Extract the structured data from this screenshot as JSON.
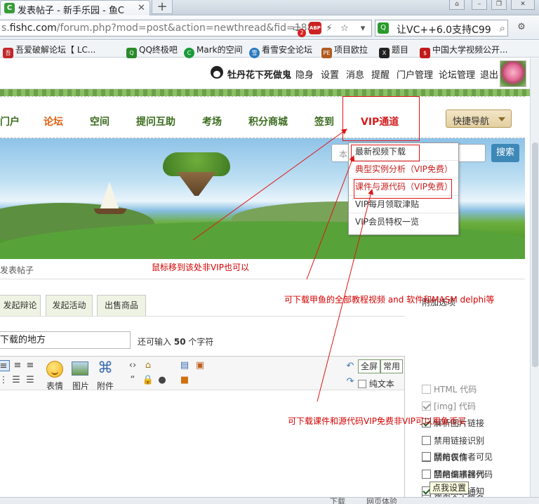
{
  "browser": {
    "tab_title": "发表帖子 - 新手乐园 - 鱼C",
    "tab_favicon": "C",
    "url_prefix": "s.",
    "url_domain": "fishc.com",
    "url_path": "/forum.php?mod=post&action=newthread&fid=188",
    "notification_count": "2",
    "adblock_label": "ABP",
    "search_query": "让VC++6.0支持C99",
    "bookmarks": [
      {
        "label": "吾爱破解论坛【 LC...",
        "icon_text": "吾"
      },
      {
        "label": "QQ终极吧",
        "icon_text": "Q"
      },
      {
        "label": "Mark的空间",
        "icon_text": "C"
      },
      {
        "label": "看雪安全论坛",
        "icon_text": "雪"
      },
      {
        "label": "项目欧拉",
        "icon_text": "PE"
      },
      {
        "label": "题目",
        "icon_text": "X"
      },
      {
        "label": "中国大学视频公开...",
        "icon_text": "$"
      }
    ]
  },
  "topbar": {
    "username": "牡丹花下死做鬼",
    "links": [
      "隐身",
      "设置",
      "消息",
      "提醒",
      "门户管理",
      "论坛管理",
      "退出"
    ]
  },
  "nav": {
    "items": [
      "门户",
      "论坛",
      "空间",
      "提问互助",
      "考场",
      "积分商城",
      "签到",
      "VIP通道"
    ],
    "quick_nav": "快捷导航"
  },
  "banner": {
    "search_placeholder": "本",
    "search_button": "搜索"
  },
  "vip_menu": {
    "items": [
      "最新视频下载",
      "典型实例分析（VIP免费）",
      "课件与源代码（VIP免费）",
      "VIP每月领取津贴",
      "VIP会员特权一览"
    ]
  },
  "breadcrumb": "发表帖子",
  "post_tabs": [
    "发起辩论",
    "发起活动",
    "出售商品"
  ],
  "title_field": {
    "value": "下载的地方",
    "hint_prefix": "还可输入",
    "hint_count": "50",
    "hint_suffix": "个字符"
  },
  "editor_toolbar": {
    "emoji_label": "表情",
    "image_label": "图片",
    "attach_label": "附件",
    "fullscreen_label": "全屏",
    "common_label": "常用",
    "plaintext_label": "纯文本"
  },
  "options": {
    "title": "附加选项",
    "items": [
      {
        "label": "HTML 代码",
        "checked": false,
        "disabled": true
      },
      {
        "label": "[img] 代码",
        "checked": true,
        "disabled": true
      },
      {
        "label": "解析图片链接",
        "checked": true,
        "disabled": false
      },
      {
        "label": "禁用链接识别",
        "checked": false,
        "disabled": false
      },
      {
        "label": "禁用表情",
        "checked": false,
        "disabled": false
      },
      {
        "label": "禁用编辑器代码",
        "checked": false,
        "disabled": false
      },
      {
        "label": "使用个人签名",
        "checked": true,
        "disabled": false
      },
      {
        "label": "回帖仅作者可见",
        "checked": false,
        "disabled": false
      },
      {
        "label": "回帖倒序排列",
        "checked": false,
        "disabled": false
      },
      {
        "label": "接收回复通知",
        "checked": true,
        "disabled": false
      }
    ]
  },
  "tooltip": "点我设置",
  "status": [
    "下载",
    "网页体验"
  ],
  "annotations": {
    "hover_hint": "鼠标移到该处非VIP也可以",
    "video_hint": "可下载甲鱼的全部教程视频 and 软件和MASM delphi等",
    "code_hint": "可下载课件和源代码VIP免费非VIP可以用鱼币买"
  },
  "colors": {
    "accent_green": "#3a6b1e",
    "nav_active": "#e06010",
    "vip_red": "#d21f1f",
    "annotation_red": "#e01515"
  }
}
